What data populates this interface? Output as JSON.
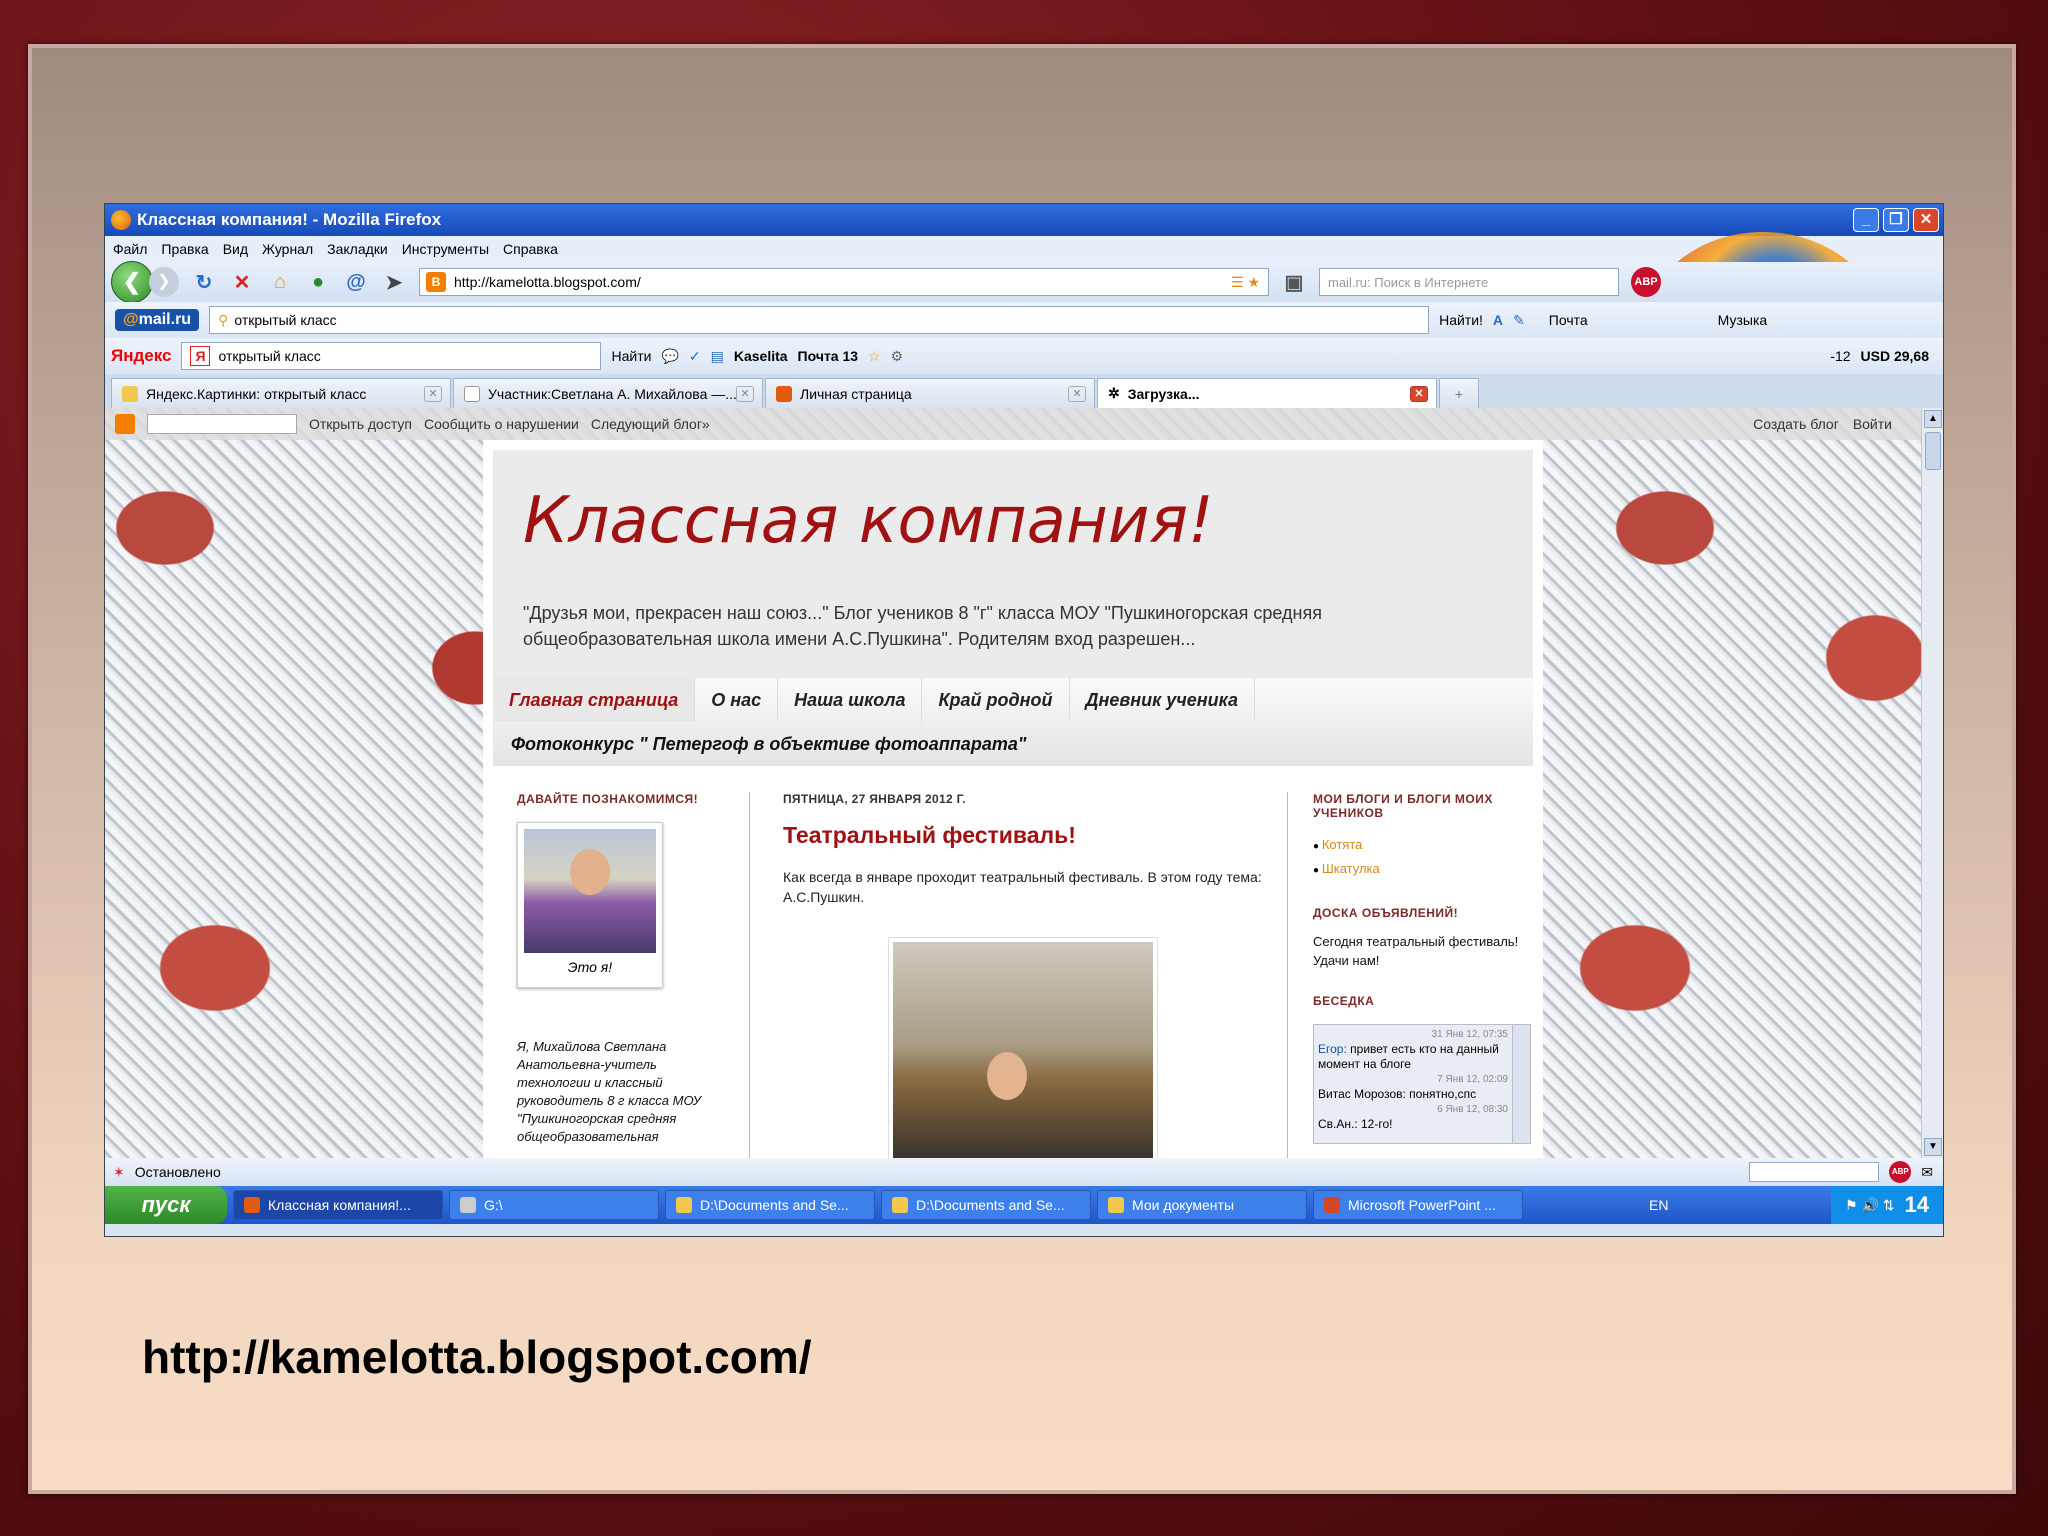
{
  "caption": "http://kamelotta.blogspot.com/",
  "window": {
    "title": "Классная компания! - Mozilla Firefox"
  },
  "menu": [
    "Файл",
    "Правка",
    "Вид",
    "Журнал",
    "Закладки",
    "Инструменты",
    "Справка"
  ],
  "nav": {
    "url": "http://kamelotta.blogspot.com/",
    "search_placeholder": "mail.ru: Поиск в Интернете",
    "abp": "ABP"
  },
  "mailbar": {
    "logo_at": "@",
    "logo": "mail.ru",
    "query": "открытый класс",
    "find": "Найти!",
    "mail": "Почта",
    "music": "Музыка"
  },
  "yabar": {
    "logo": "Яндекс",
    "query": "открытый класс",
    "find": "Найти",
    "user": "Kaselita",
    "mail": "Почта 13",
    "weather": "-12",
    "usd": "USD 29,68"
  },
  "tabs": [
    {
      "label": "Яндекс.Картинки: открытый класс"
    },
    {
      "label": "Участник:Светлана А. Михайлова —..."
    },
    {
      "label": "Личная страница"
    },
    {
      "label": "Загрузка..."
    }
  ],
  "blogbar": {
    "share": "Открыть доступ",
    "report": "Сообщить о нарушении",
    "next": "Следующий блог»",
    "create": "Создать блог",
    "login": "Войти"
  },
  "blog": {
    "title": "Классная компания!",
    "description": "\"Друзья мои, прекрасен наш союз...\" Блог учеников 8 \"г\" класса МОУ \"Пушкиногорская средняя общеобразовательная школа имени А.С.Пушкина\". Родителям вход разрешен...",
    "nav": [
      "Главная страница",
      "О нас",
      "Наша школа",
      "Край родной",
      "Дневник ученика"
    ],
    "nav2": "Фотоконкурс \" Петергоф в объективе фотоаппарата\"",
    "left": {
      "heading": "ДАВАЙТЕ ПОЗНАКОМИМСЯ!",
      "photo_caption": "Это я!",
      "bio": "Я, Михайлова Светлана Анатольевна-учитель технологии и классный руководитель 8 г класса МОУ \"Пушкиногорская средняя общеобразовательная"
    },
    "post": {
      "date": "ПЯТНИЦА, 27 ЯНВАРЯ 2012 Г.",
      "title": "Театральный фестиваль!",
      "body": "Как всегда в январе проходит театральный фестиваль. В этом году тема: А.С.Пушкин."
    },
    "right": {
      "blogs_heading": "МОИ БЛОГИ И БЛОГИ МОИХ УЧЕНИКОВ",
      "blogs": [
        "Котята",
        "Шкатулка"
      ],
      "board_heading": "ДОСКА ОБЪЯВЛЕНИЙ!",
      "board_text": "Сегодня театральный фестиваль! Удачи нам!",
      "chat_heading": "БЕСЕДКА",
      "chat": [
        {
          "time": "31 Янв 12, 07:35",
          "name": "Егор:",
          "text": "привет есть кто на данный момент на блоге"
        },
        {
          "time": "7 Янв 12, 02:09",
          "name": "",
          "text": "Витас Морозов: понятно,спс"
        },
        {
          "time": "6 Янв 12, 08:30",
          "name": "",
          "text": "Св.Ан.: 12-го!"
        }
      ]
    }
  },
  "status": "Остановлено",
  "taskbar": {
    "start": "пуск",
    "tasks": [
      "Классная компания!...",
      "G:\\",
      "D:\\Documents and Se...",
      "D:\\Documents and Se...",
      "Мои документы",
      "Microsoft PowerPoint ..."
    ],
    "lang": "EN",
    "clock": "14"
  }
}
